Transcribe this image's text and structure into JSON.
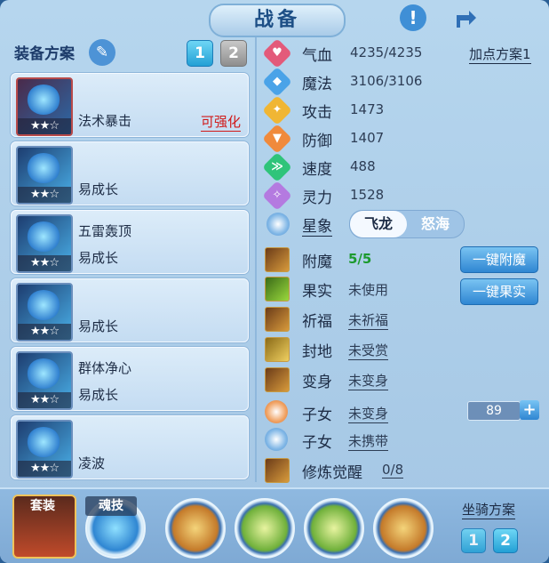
{
  "title": "战备",
  "top_icons": {
    "info": "!",
    "share": "share-icon"
  },
  "equipment": {
    "header": "装备方案",
    "plans": [
      "1",
      "2"
    ],
    "active_plan": "1",
    "cards": [
      {
        "name": "法术暴击",
        "sub": "",
        "action": "可强化",
        "stars": "★★☆"
      },
      {
        "name": "易成长",
        "sub": "",
        "action": "",
        "stars": "★★☆"
      },
      {
        "name": "五雷轰顶",
        "sub": "易成长",
        "action": "",
        "stars": "★★☆"
      },
      {
        "name": "易成长",
        "sub": "",
        "action": "",
        "stars": "★★☆"
      },
      {
        "name": "群体净心",
        "sub": "易成长",
        "action": "",
        "stars": "★★☆"
      },
      {
        "name": "凌波",
        "sub": "",
        "action": "",
        "stars": "★★☆"
      }
    ]
  },
  "stats": {
    "add_points_label": "加点方案1",
    "items": [
      {
        "label": "气血",
        "value": "4235/4235",
        "color": "#e35a7a",
        "glyph": "♥"
      },
      {
        "label": "魔法",
        "value": "3106/3106",
        "color": "#4aa3e8",
        "glyph": "◆"
      },
      {
        "label": "攻击",
        "value": "1473",
        "color": "#f0b634",
        "glyph": "✦"
      },
      {
        "label": "防御",
        "value": "1407",
        "color": "#f08a3c",
        "glyph": "▼"
      },
      {
        "label": "速度",
        "value": "488",
        "color": "#2fc47a",
        "glyph": "≫"
      },
      {
        "label": "灵力",
        "value": "1528",
        "color": "#b47ae0",
        "glyph": "✧"
      }
    ],
    "star_label": "星象",
    "star_toggle": [
      "飞龙",
      "怒海"
    ]
  },
  "extras": {
    "items": [
      {
        "label": "附魔",
        "value": "5/5",
        "style": "green"
      },
      {
        "label": "果实",
        "value": "未使用",
        "style": "plain"
      },
      {
        "label": "祈福",
        "value": "未祈福",
        "style": "u"
      },
      {
        "label": "封地",
        "value": "未受赏",
        "style": "u"
      },
      {
        "label": "变身",
        "value": "未变身",
        "style": "u"
      },
      {
        "label": "子女",
        "value": "未变身",
        "style": "u"
      },
      {
        "label": "子女",
        "value": "未携带",
        "style": "u"
      },
      {
        "label": "修炼觉醒",
        "value": "0/8",
        "style": "u"
      }
    ],
    "buttons": {
      "enchant": "一键附魔",
      "fruit": "一键果实"
    },
    "child_level": "89"
  },
  "bottom": {
    "set_label": "套装",
    "soul_label": "魂技",
    "mount_label": "坐骑方案",
    "mount_plans": [
      "1",
      "2"
    ]
  }
}
